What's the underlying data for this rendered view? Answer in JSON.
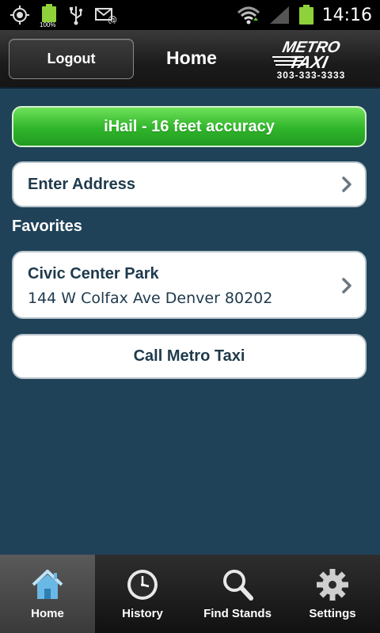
{
  "status_bar": {
    "time": "14:16",
    "battery_percent": "100%",
    "icons": [
      "gps-icon",
      "battery-icon",
      "usb-icon",
      "email-icon",
      "wifi-icon",
      "signal-icon",
      "battery-icon"
    ]
  },
  "header": {
    "logout_label": "Logout",
    "title": "Home",
    "logo_line1": "METRO",
    "logo_line2": "TAXI",
    "logo_phone": "303-333-3333"
  },
  "main": {
    "ihail_label": "iHail - 16 feet accuracy",
    "enter_address_label": "Enter Address",
    "favorites_title": "Favorites",
    "favorites": [
      {
        "name": "Civic Center Park",
        "address": "144 W Colfax Ave Denver 80202"
      }
    ],
    "call_label": "Call Metro Taxi"
  },
  "tabs": [
    {
      "label": "Home",
      "icon": "home-icon",
      "active": true
    },
    {
      "label": "History",
      "icon": "clock-icon",
      "active": false
    },
    {
      "label": "Find Stands",
      "icon": "magnifier-icon",
      "active": false
    },
    {
      "label": "Settings",
      "icon": "gear-icon",
      "active": false
    }
  ],
  "colors": {
    "background": "#1f4258",
    "accent_green": "#2fb52a",
    "text_dark": "#1e3a4c"
  }
}
